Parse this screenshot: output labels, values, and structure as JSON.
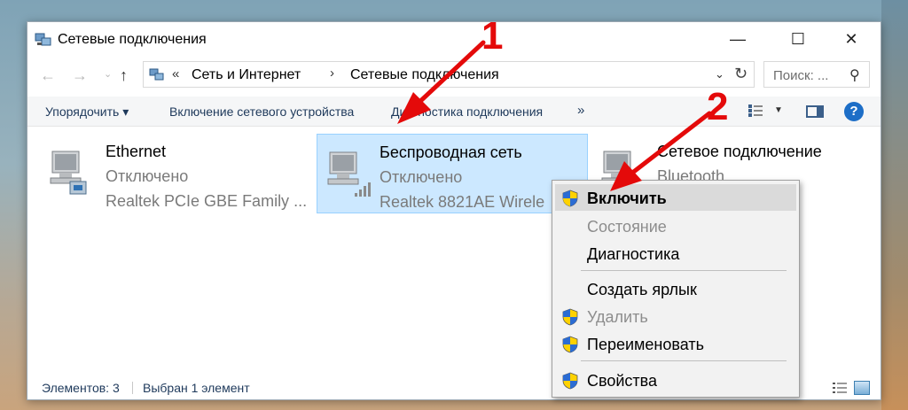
{
  "window": {
    "title": "Сетевые подключения",
    "controls": {
      "minimize": "—",
      "maximize": "☐",
      "close": "✕"
    }
  },
  "address_bar": {
    "separator": "«",
    "crumbs": [
      "Сеть и Интернет",
      "Сетевые подключения"
    ],
    "crumb_separator": "›",
    "search_placeholder": "Поиск: ..."
  },
  "toolbar": {
    "organize": "Упорядочить ▾",
    "enable_device": "Включение сетевого устройства",
    "diagnostics": "Диагностика подключения",
    "more": "»"
  },
  "connections": [
    {
      "name": "Ethernet",
      "status": "Отключено",
      "device": "Realtek PCIe GBE Family ..."
    },
    {
      "name": "Беспроводная сеть",
      "status": "Отключено",
      "device": "Realtek 8821AE Wirele",
      "selected": true
    },
    {
      "name": "Сетевое подключение",
      "status": "Bluetooth",
      "device": ""
    }
  ],
  "status_bar": {
    "count": "Элементов: 3",
    "selected": "Выбран 1 элемент"
  },
  "context_menu": {
    "items": [
      {
        "label": "Включить",
        "shield": true,
        "bold": true,
        "disabled": false,
        "hover": true
      },
      {
        "label": "Состояние",
        "shield": false,
        "bold": false,
        "disabled": true
      },
      {
        "label": "Диагностика",
        "shield": false,
        "bold": false,
        "disabled": false
      },
      {
        "label": "Создать ярлык",
        "shield": false,
        "bold": false,
        "disabled": false
      },
      {
        "label": "Удалить",
        "shield": true,
        "bold": false,
        "disabled": true
      },
      {
        "label": "Переименовать",
        "shield": true,
        "bold": false,
        "disabled": false
      },
      {
        "label": "Свойства",
        "shield": true,
        "bold": false,
        "disabled": false
      }
    ]
  },
  "annotations": {
    "step1": "1",
    "step2": "2",
    "arrow_color": "#e40a0a"
  },
  "colors": {
    "selection_bg": "#cce8ff",
    "toolbar_text": "#1e395b",
    "help_blue": "#1d6ec7"
  }
}
